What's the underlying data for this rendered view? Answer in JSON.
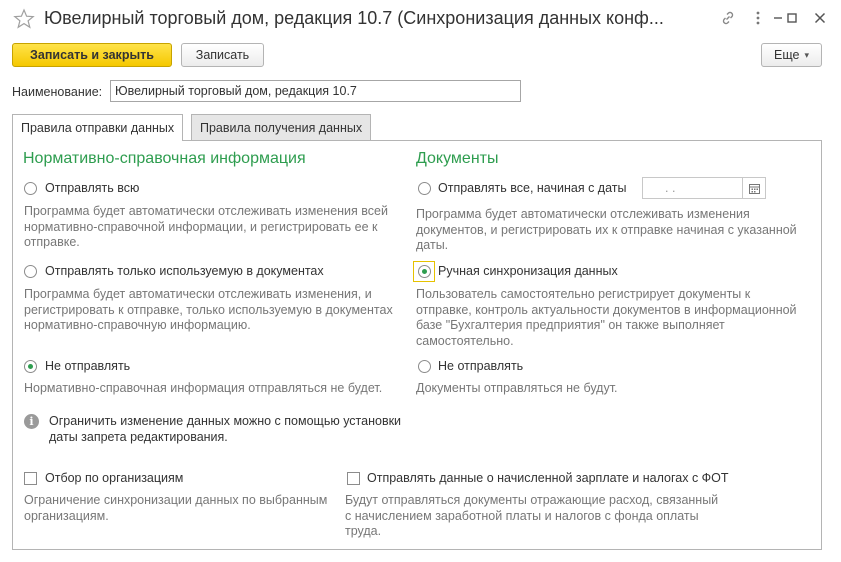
{
  "window": {
    "title": "Ювелирный торговый дом, редакция 10.7 (Синхронизация данных конф...",
    "star_icon": "star-icon",
    "link_icon": "link-icon",
    "menu_icon": "more-vertical-icon",
    "minimize_icon": "minimize-icon",
    "maximize_icon": "maximize-icon",
    "close_icon": "close-icon"
  },
  "toolbar": {
    "save_close_label": "Записать и закрыть",
    "save_label": "Записать",
    "more_label": "Еще",
    "more_arrow": "▾"
  },
  "name_field": {
    "label": "Наименование:",
    "value": "Ювелирный торговый дом, редакция 10.7"
  },
  "tabs": [
    {
      "label": "Правила отправки данных",
      "active": true
    },
    {
      "label": "Правила получения данных",
      "active": false
    }
  ],
  "nsi": {
    "header": "Нормативно-справочная информация",
    "options": [
      {
        "label": "Отправлять всю",
        "selected": false,
        "desc": [
          "Программа будет автоматически отслеживать изменения всей",
          "нормативно-справочной информации, и регистрировать ее к",
          "отправке."
        ]
      },
      {
        "label": "Отправлять только используемую в документах",
        "selected": false,
        "desc": [
          "Программа будет автоматически отслеживать изменения, и",
          "регистрировать к отправке, только используемую в документах",
          "нормативно-справочную информацию."
        ]
      },
      {
        "label": "Не отправлять",
        "selected": true,
        "desc": [
          "Нормативно-справочная информация отправляться не будет."
        ]
      }
    ]
  },
  "docs": {
    "header": "Документы",
    "date_placeholder": " .  .",
    "options": [
      {
        "label": "Отправлять все, начиная с даты",
        "selected": false,
        "desc": [
          "Программа будет автоматически отслеживать изменения",
          "документов, и регистрировать их к отправке начиная с указанной",
          "даты."
        ]
      },
      {
        "label": "Ручная синхронизация данных",
        "selected": true,
        "desc": [
          "Пользователь самостоятельно регистрирует документы к",
          "отправке, контроль актуальности документов в информационной",
          "базе \"Бухгалтерия предприятия\" он также выполняет",
          "самостоятельно."
        ]
      },
      {
        "label": "Не отправлять",
        "selected": false,
        "desc": [
          "Документы отправляться не будут."
        ]
      }
    ]
  },
  "info": {
    "glyph": "i",
    "lines": [
      "Ограничить изменение данных можно с помощью установки",
      "даты запрета редактирования."
    ]
  },
  "checks": [
    {
      "label": "Отбор по организациям",
      "checked": false,
      "desc": [
        "Ограничение синхронизации данных по выбранным",
        "организациям."
      ]
    },
    {
      "label": "Отправлять данные о начисленной зарплате и налогах с ФОТ",
      "checked": false,
      "desc": [
        "Будут отправляться документы отражающие расход, связанный",
        "с начислением заработной платы и налогов с фонда оплаты",
        "труда."
      ]
    }
  ],
  "colors": {
    "accent_green": "#2e9d4f",
    "primary_yellow": "#f5c800",
    "desc_gray": "#777777"
  }
}
